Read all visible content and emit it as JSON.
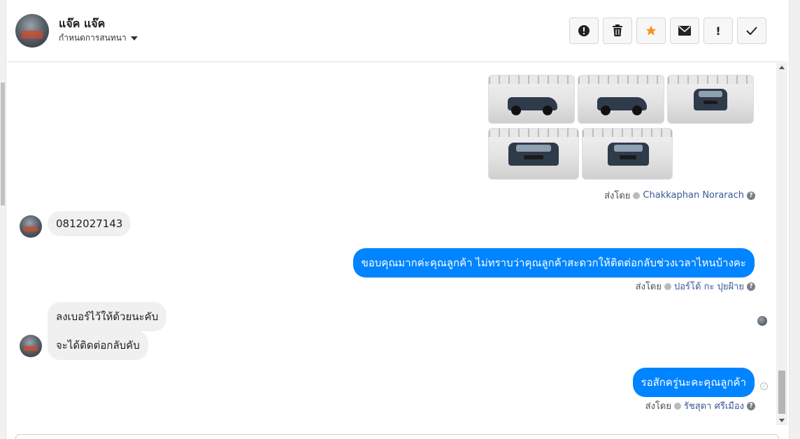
{
  "header": {
    "name": "แจ๊ค แจ๊ค",
    "subtitle": "กำหนดการสนทนา",
    "actions": [
      {
        "icon": "alert-circle-icon",
        "glyph": "❗"
      },
      {
        "icon": "trash-icon",
        "glyph": "🗑"
      },
      {
        "icon": "star-icon",
        "glyph": "★"
      },
      {
        "icon": "envelope-icon",
        "glyph": "✉"
      },
      {
        "icon": "exclamation-icon",
        "glyph": "!"
      },
      {
        "icon": "check-icon",
        "glyph": "✓"
      }
    ]
  },
  "messages": {
    "images_meta": {
      "label": "ส่งโดย",
      "sender": "Chakkaphan Norarach"
    },
    "phone": "0812027143",
    "out1": {
      "text": "ขอบคุณมากค่ะคุณลูกค้า ไม่ทราบว่าคุณลูกค้าสะดวกให้ติดต่อกลับช่วงเวลาไหนบ้างคะ",
      "label": "ส่งโดย",
      "sender": "ปอร์โต้ กะ ปุยฝ้าย"
    },
    "in2": "ลงเบอร์ไว้ให้ด้วยนะคับ",
    "in3": "จะได้ติดต่อกลับคับ",
    "out2": {
      "text": "รอสักครู่นะคะคุณลูกค้า",
      "label": "ส่งโดย",
      "sender": "รัชสุดา ศรีเมือง"
    }
  },
  "colors": {
    "accent": "#0084ff",
    "star": "#f7931e"
  }
}
